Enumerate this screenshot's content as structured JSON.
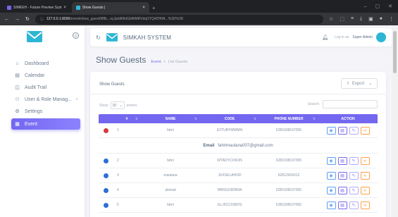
{
  "browser": {
    "tabs": [
      {
        "title": "SIMKEH - Future Preview Syst",
        "active": false
      },
      {
        "title": "Show Guests |",
        "active": true
      }
    ],
    "url_host": "127.0.0.1:8000",
    "url_path": "/event/show_guest/9f8b...eyJpdiI6IktGblNMRVdqOTQ4ZHhB...%3D%3D"
  },
  "sidebar": {
    "items": [
      {
        "label": "Dashboard",
        "icon": "home-icon",
        "glyph": "⌂"
      },
      {
        "label": "Calendar",
        "icon": "calendar-icon",
        "glyph": "▤"
      },
      {
        "label": "Audit Trail",
        "icon": "audit-icon",
        "glyph": "◫"
      },
      {
        "label": "User & Role Manag...",
        "icon": "users-icon",
        "glyph": "⚇"
      },
      {
        "label": "Settings",
        "icon": "gear-icon",
        "glyph": "⚙"
      },
      {
        "label": "Event",
        "icon": "grid-icon",
        "glyph": "▦"
      }
    ]
  },
  "navbar": {
    "title": "SIMKAH SYSTEM",
    "login_prefix": "Log in as",
    "role": "Super Admin"
  },
  "page": {
    "title": "Show Guests",
    "breadcrumb_parent": "Event",
    "breadcrumb_current": "List Guests"
  },
  "card": {
    "title": "Show Guests",
    "export_label": "Export",
    "show_label": "Show",
    "length_value": "10",
    "entries_label": "entries",
    "search_label": "Search:"
  },
  "table": {
    "headers": [
      "#",
      "NAME",
      "CODE",
      "PHONE NUMBER",
      "ACTION"
    ],
    "rows": [
      {
        "no": "1",
        "name": "fahri",
        "code": "E2TUBYMWMN",
        "phone": "6281938197055",
        "expanded": true
      },
      {
        "no": "2",
        "name": "fahri",
        "code": "WTADYCXWJN",
        "phone": "6281938197055",
        "expanded": false
      },
      {
        "no": "3",
        "name": "maulana",
        "code": "JUXSKLAHOD",
        "phone": "62812424312",
        "expanded": false
      },
      {
        "no": "4",
        "name": "ahmad",
        "code": "WBSGO9DB9A",
        "phone": "6281938197055",
        "expanded": false
      },
      {
        "no": "5",
        "name": "fahri",
        "code": "GLJ9CC0S8VS",
        "phone": "6281938197055",
        "expanded": false
      }
    ],
    "detail_label": "Email",
    "detail_value": "fahrimaulana007@gmail.com"
  },
  "colors": {
    "primary": "#7367f0",
    "accent_blue": "#2b6fd6",
    "danger": "#d43b3b",
    "warning": "#ff9f43"
  }
}
